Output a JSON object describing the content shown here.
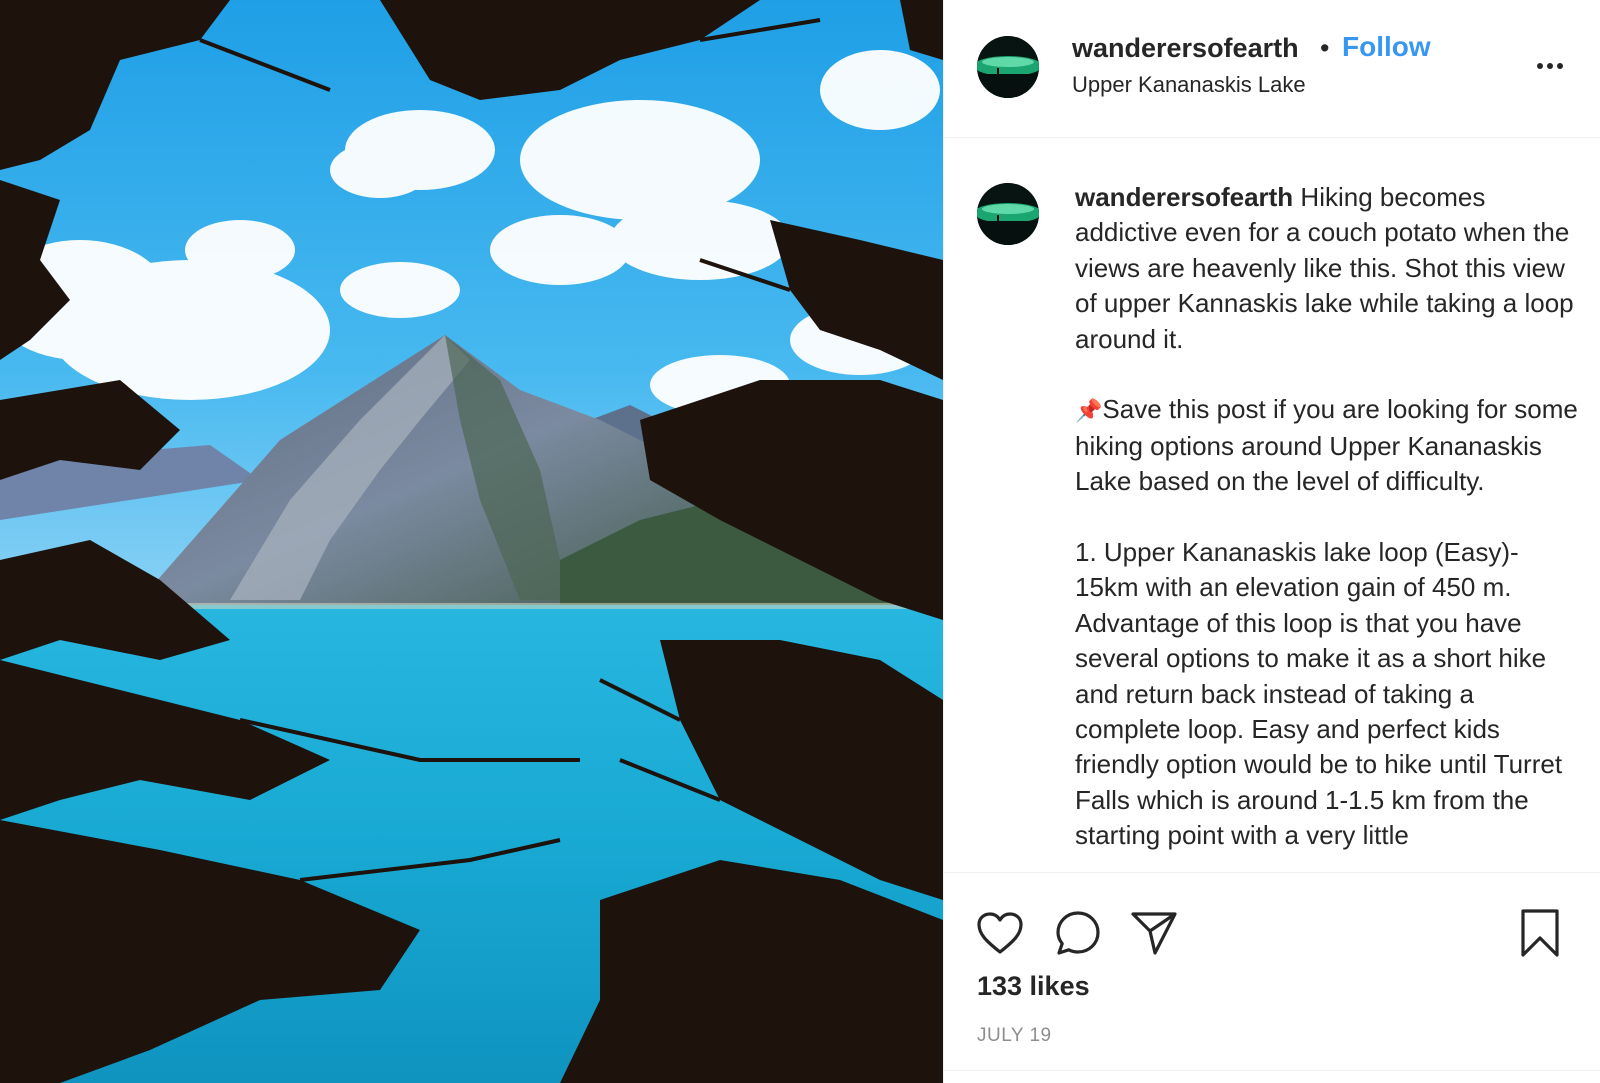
{
  "post": {
    "author": "wanderersofearth",
    "follow_label": "Follow",
    "separator": "•",
    "location": "Upper Kananaskis Lake",
    "caption": {
      "username": "wanderersofearth",
      "intro": "Hiking becomes addictive even for a couch potato when the views are heavenly like this. Shot this view of upper Kannaskis lake while taking a loop around it.",
      "pin_emoji": "📌",
      "save_text": "Save this post if you are looking for some hiking options around Upper Kananaskis Lake based on the level of difficulty.",
      "item1": "1. Upper Kananaskis lake loop (Easy)- 15km with an elevation gain of 450 m. Advantage of this loop is that you have several options to make it as a short hike and return back instead of taking a complete loop. Easy and perfect kids friendly option would be to hike until Turret Falls which is around 1-1.5 km from the starting point with a very little"
    },
    "likes": "133 likes",
    "date": "JULY 19"
  },
  "icons": {
    "more": "more-options-icon",
    "like": "heart-icon",
    "comment": "comment-bubble-icon",
    "share": "paper-plane-icon",
    "save": "bookmark-icon"
  },
  "colors": {
    "follow": "#3897f0",
    "text": "#262626",
    "muted": "#8e8e8e",
    "border": "#efefef",
    "sky": "#2fa8ea",
    "lake": "#1cb3d6"
  }
}
